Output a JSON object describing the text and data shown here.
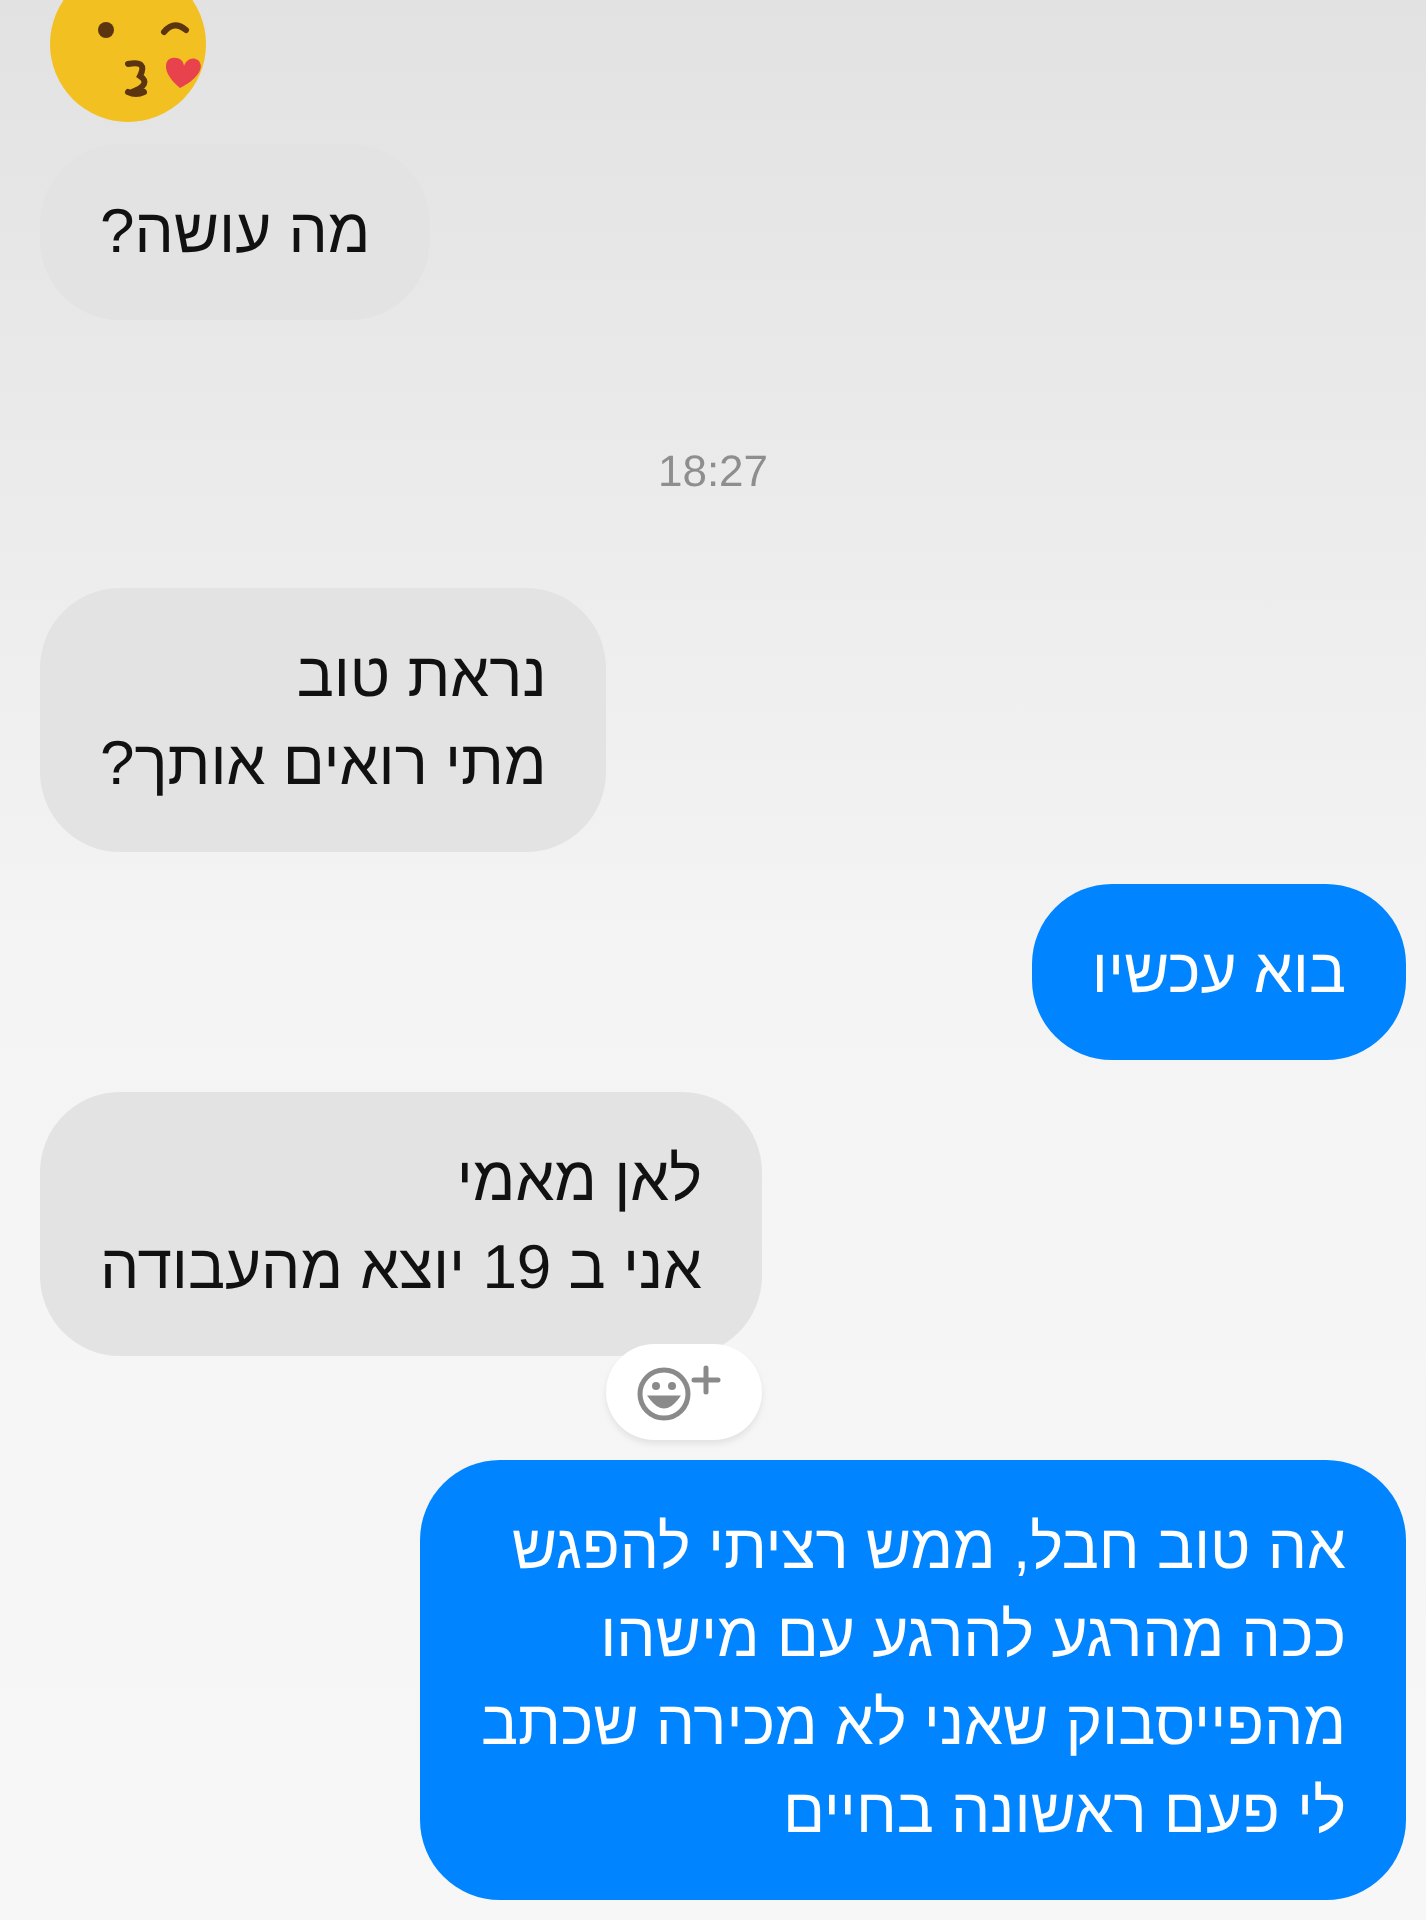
{
  "messages": [
    {
      "kind": "sticker"
    },
    {
      "kind": "incoming",
      "text": "מה עושה?",
      "reaction_button": false
    },
    {
      "kind": "timestamp",
      "text": "18:27"
    },
    {
      "kind": "incoming",
      "text": "נראת טוב\nמתי רואים אותך?",
      "reaction_button": false
    },
    {
      "kind": "outgoing",
      "text": "בוא עכשיו"
    },
    {
      "kind": "incoming",
      "text": "לאן מאמי\nאני ב 19 יוצא מהעבודה",
      "reaction_button": true
    },
    {
      "kind": "outgoing",
      "text": "אה טוב חבל, ממש רציתי להפגש\nככה מהרגע להרגע עם מישהו\nמהפייסבוק שאני לא מכירה שכתב\nלי פעם ראשונה בחיים"
    }
  ]
}
